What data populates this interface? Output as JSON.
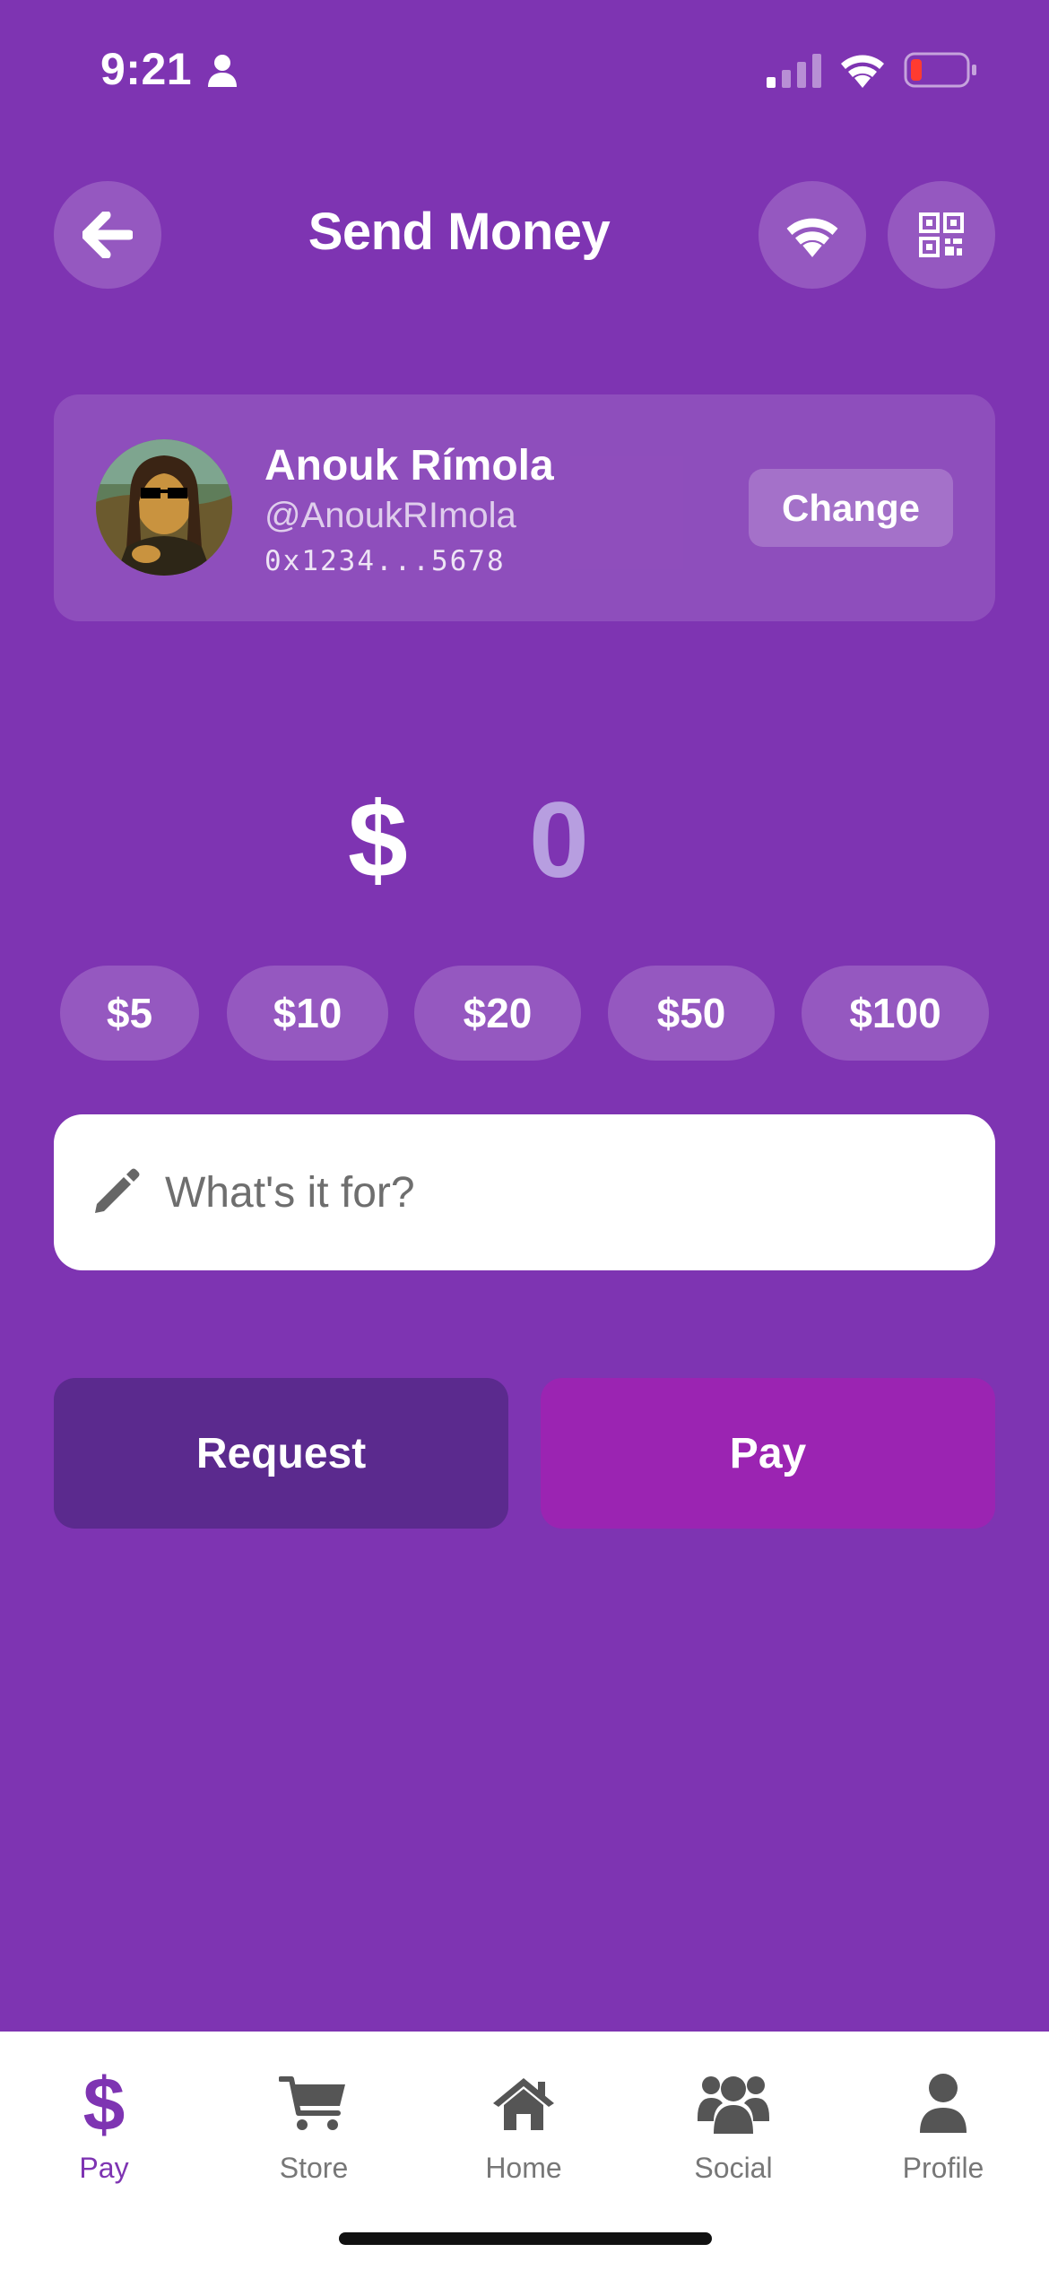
{
  "status_bar": {
    "time": "9:21",
    "battery_color": "#ff3b30"
  },
  "header": {
    "title": "Send Money",
    "back_icon": "arrow-left-icon",
    "nfc_icon": "wifi-icon",
    "qr_icon": "qr-code-icon"
  },
  "recipient": {
    "name": "Anouk Rímola",
    "handle": "@AnoukRImola",
    "address": "0x1234...5678",
    "change_label": "Change"
  },
  "amount": {
    "currency": "$",
    "value": "0"
  },
  "quick_amounts": [
    "$5",
    "$10",
    "$20",
    "$50",
    "$100"
  ],
  "note": {
    "placeholder": "What's it for?",
    "value": ""
  },
  "actions": {
    "request_label": "Request",
    "pay_label": "Pay"
  },
  "tabs": [
    {
      "label": "Pay",
      "icon": "dollar-icon",
      "active": true
    },
    {
      "label": "Store",
      "icon": "cart-icon",
      "active": false
    },
    {
      "label": "Home",
      "icon": "home-icon",
      "active": false
    },
    {
      "label": "Social",
      "icon": "users-icon",
      "active": false
    },
    {
      "label": "Profile",
      "icon": "user-icon",
      "active": false
    }
  ],
  "colors": {
    "background": "#7e34b2",
    "accent": "#7e34b2",
    "request_button": "#5b2a8e",
    "pay_button": "#9b24b2",
    "amount_placeholder": "#b79ee0"
  }
}
